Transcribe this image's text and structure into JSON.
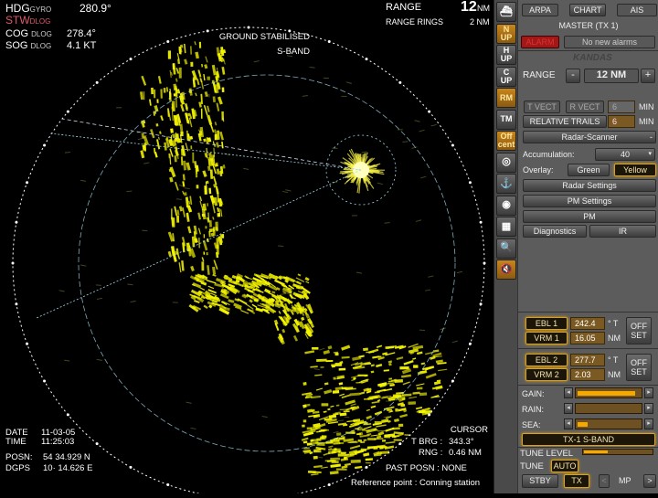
{
  "nav": {
    "hdg_label": "HDG",
    "hdg_src": "GYRO",
    "hdg_value": "280.9°",
    "stw_label": "STW",
    "stw_src": "DLOG",
    "cog_label": "COG",
    "cog_src": "DLOG",
    "cog_value": "278.4°",
    "sog_label": "SOG",
    "sog_src": "DLOG",
    "sog_value": "4.1 KT"
  },
  "display": {
    "range_label": "RANGE",
    "range_value": "12",
    "range_unit": "NM",
    "rings_label": "RANGE RINGS",
    "rings_value": "2 NM",
    "stabilisation": "GROUND STABILISED",
    "band": "S-BAND"
  },
  "time": {
    "date_label": "DATE",
    "date": "11-03-05",
    "time_label": "TIME",
    "time": "11:25:03"
  },
  "position": {
    "posn_label": "POSN:",
    "lat": "54  34.929 N",
    "dgps_label": "DGPS",
    "lon": "10·  14.626 E"
  },
  "cursor": {
    "title": "CURSOR",
    "tbrg_label": "T BRG :",
    "tbrg": "343.3°",
    "rng_label": "RNG :",
    "rng": "0.46 NM",
    "past_posn": "PAST POSN : NONE",
    "reference": "Reference point : Conning station"
  },
  "toolbar": [
    {
      "label": "",
      "icon": "ship-icon",
      "active": false
    },
    {
      "label": "N UP",
      "active": true
    },
    {
      "label": "H UP",
      "active": false
    },
    {
      "label": "C UP",
      "active": false
    },
    {
      "label": "RM",
      "active": true
    },
    {
      "label": "TM",
      "active": false
    },
    {
      "label": "Off cent",
      "active": true
    },
    {
      "label": "",
      "icon": "target-icon",
      "active": false
    },
    {
      "label": "",
      "icon": "anchor-icon",
      "active": false
    },
    {
      "label": "",
      "icon": "rings-icon",
      "active": false
    },
    {
      "label": "",
      "icon": "grid-icon",
      "active": false
    },
    {
      "label": "",
      "icon": "zoom-page-icon",
      "active": false
    },
    {
      "label": "",
      "icon": "mute-icon",
      "active": true
    }
  ],
  "panel": {
    "tabs": [
      "ARPA",
      "CHART",
      "AIS"
    ],
    "master": "MASTER (TX 1)",
    "alarm_button": "ALARM",
    "alarm_text": "No new alarms",
    "brand": "KANDAS",
    "range_label": "RANGE",
    "range_minus": "-",
    "range_value": "12 NM",
    "range_plus": "+",
    "tvect": "T VECT",
    "rvect": "R VECT",
    "vect_value": "6",
    "vect_unit": "MIN",
    "trails": "RELATIVE TRAILS",
    "trails_value": "6",
    "trails_unit": "MIN",
    "source": "Radar-Scanner",
    "accum_label": "Accumulation:",
    "accum_value": "40",
    "overlay_label": "Overlay:",
    "overlay_green": "Green",
    "overlay_yellow": "Yellow",
    "radar_settings": "Radar Settings",
    "pm_settings": "PM Settings",
    "pm": "PM",
    "diagnostics": "Diagnostics",
    "ir": "IR",
    "ebl1": "EBL 1",
    "ebl1_value": "242.4",
    "ebl_unit": "° T",
    "vrm1": "VRM 1",
    "vrm1_value": "16.05",
    "vrm_unit": "NM",
    "ebl2": "EBL 2",
    "ebl2_value": "277.7",
    "vrm2": "VRM 2",
    "vrm2_value": "2.03",
    "offset": "OFF SET",
    "gain_label": "GAIN:",
    "gain": 0.9,
    "rain_label": "RAIN:",
    "rain": 0.0,
    "sea_label": "SEA:",
    "sea": 0.15,
    "tx_band": "TX-1  S-BAND",
    "tune_level_label": "TUNE LEVEL",
    "tune_level": 0.35,
    "tune_label": "TUNE",
    "tune_mode": "AUTO",
    "stby": "STBY",
    "tx": "TX",
    "mp": "MP",
    "prev": "<",
    "next": ">"
  },
  "colors": {
    "echo": "#f5f500",
    "accent": "#d8a020",
    "ring": "#ffffff",
    "ebl": "#9fd8e8"
  }
}
